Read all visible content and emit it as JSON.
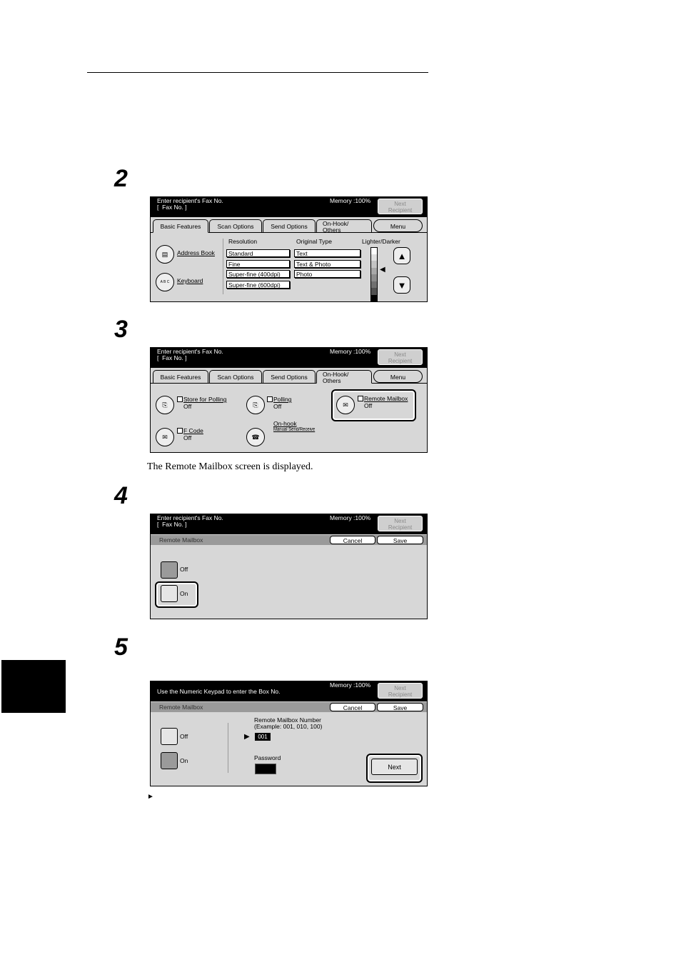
{
  "steps": [
    "2",
    "3",
    "4",
    "5"
  ],
  "caption_step3": "The Remote Mailbox screen is displayed.",
  "bullet": "►",
  "common": {
    "fax_prompt": "Enter recipient's Fax No.\n[  Fax No. ]",
    "memory": "Memory :100%",
    "next_recipient": "Next\nRecipient",
    "tabs": [
      "Basic Features",
      "Scan Options",
      "Send Options",
      "On-Hook/\nOthers"
    ],
    "menu": "Menu"
  },
  "screen1": {
    "address_book": "Address Book",
    "keyboard": "Keyboard",
    "keyboard_icon": "A B C",
    "resolution_title": "Resolution",
    "resolutions": [
      "Standard",
      "Fine",
      "Super-fine (400dpi)",
      "Super-fine (600dpi)"
    ],
    "original_type_title": "Original Type",
    "original_types": [
      "Text",
      "Text & Photo",
      "Photo"
    ],
    "lighter_darker": "Lighter/Darker",
    "lighter_levels": [
      "#ffffff",
      "#e0e0e0",
      "#c4c4c4",
      "#a8a8a8",
      "#8c8c8c",
      "#707070",
      "#505050",
      "#000000"
    ]
  },
  "screen2": {
    "store_for_polling": "Store for Polling",
    "polling": "Polling",
    "remote_mailbox": "Remote Mailbox",
    "f_code": "F Code",
    "on_hook": "On-hook",
    "manual": "Manual Send/Receive",
    "off": "Off"
  },
  "screen3": {
    "title": "Remote Mailbox",
    "cancel": "Cancel",
    "save": "Save",
    "off": "Off",
    "on": "On"
  },
  "screen4": {
    "prompt": "Use the Numeric Keypad to enter the Box No.",
    "title": "Remote Mailbox",
    "cancel": "Cancel",
    "save": "Save",
    "off": "Off",
    "on": "On",
    "number_label": "Remote Mailbox Number\n(Example: 001, 010, 100)",
    "number_value": "001",
    "password_label": "Password",
    "next": "Next"
  }
}
